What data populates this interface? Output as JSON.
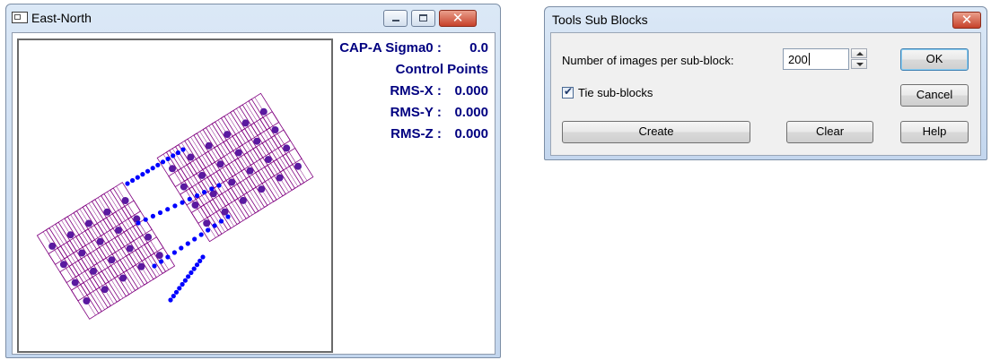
{
  "east_north_window": {
    "title": "East-North",
    "stats": {
      "sigma_label": "CAP-A Sigma0 :",
      "sigma_value": "0.0",
      "control_points_label": "Control Points",
      "rms_x_label": "RMS-X :",
      "rms_x_value": "0.000",
      "rms_y_label": "RMS-Y :",
      "rms_y_value": "0.000",
      "rms_z_label": "RMS-Z :",
      "rms_z_value": "0.000"
    },
    "plot_colors": {
      "footprint": "#800080",
      "tie_point": "#0000ff",
      "large_point": "#5a1aa0"
    }
  },
  "tools_sub_blocks_dialog": {
    "title": "Tools Sub Blocks",
    "images_label": "Number of images per sub-block:",
    "images_value": "200",
    "tie_label": "Tie sub-blocks",
    "tie_checked": true,
    "ok_label": "OK",
    "cancel_label": "Cancel",
    "create_label": "Create",
    "clear_label": "Clear",
    "help_label": "Help"
  }
}
